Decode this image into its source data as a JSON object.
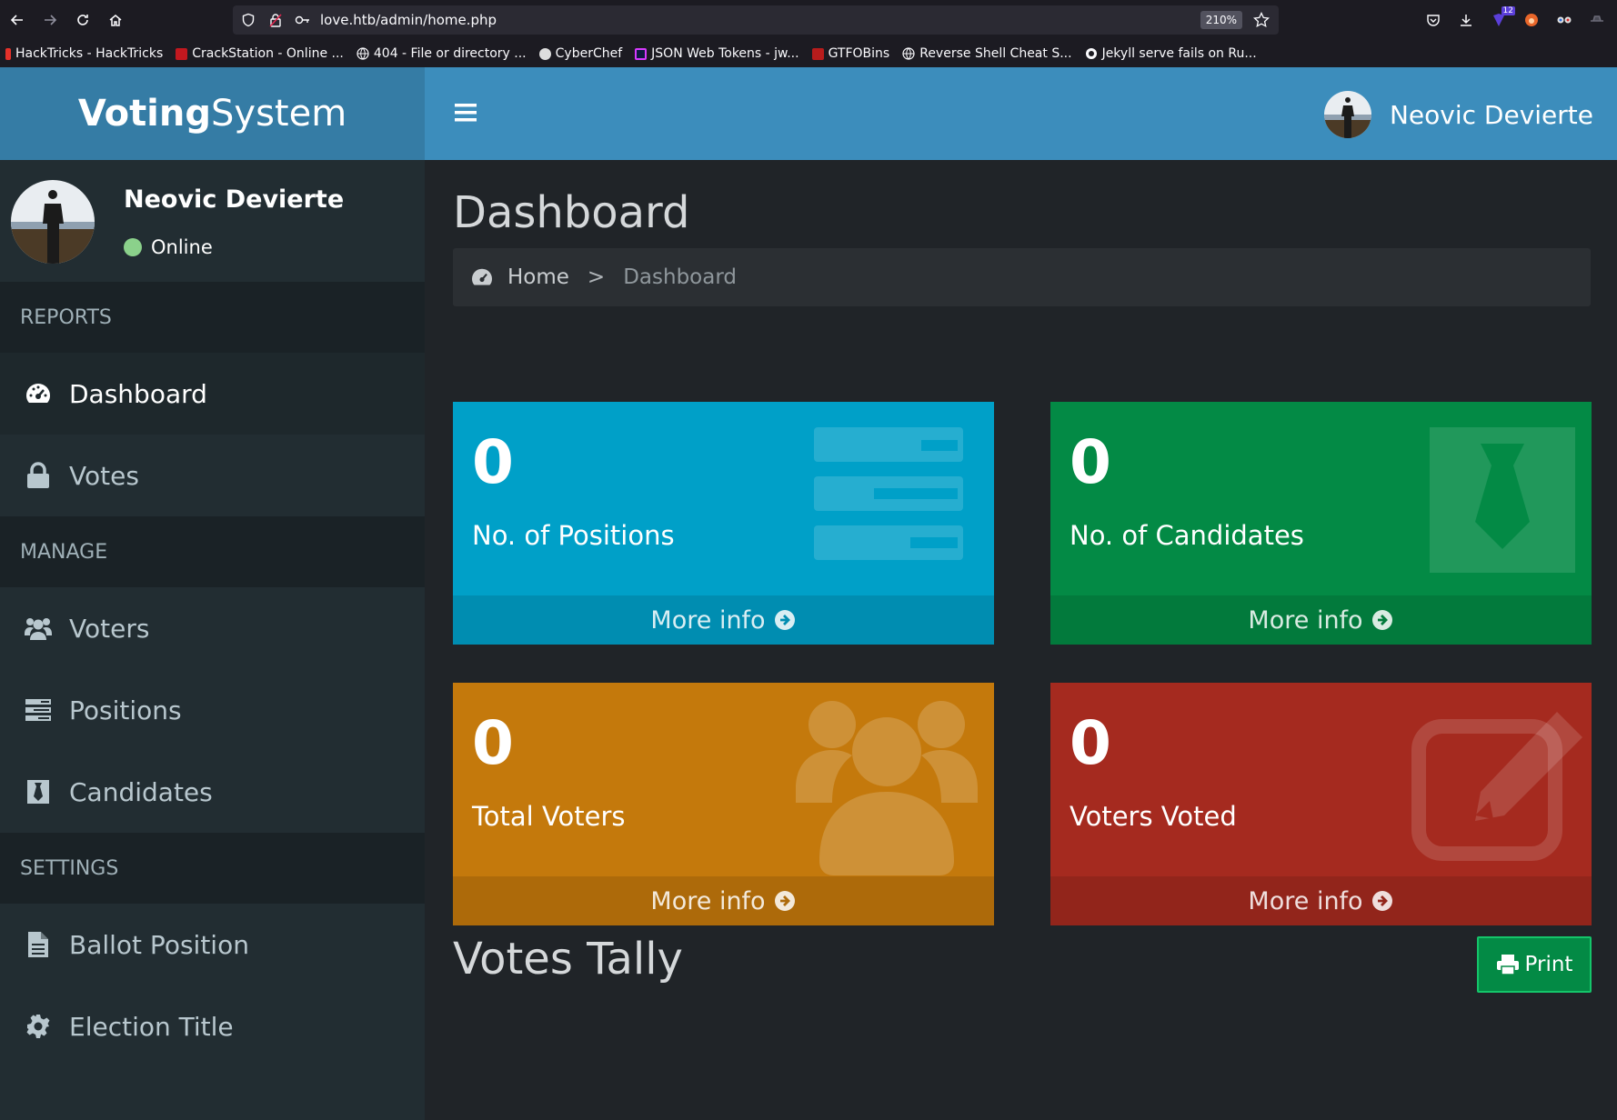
{
  "browser": {
    "url": "love.htb/admin/home.php",
    "zoom": "210%",
    "notification_count": "12",
    "bookmarks": [
      {
        "label": "HackTricks - HackTricks",
        "color": "#e5312a"
      },
      {
        "label": "CrackStation - Online ...",
        "color": "#c2181f"
      },
      {
        "label": "404 - File or directory ...",
        "color": "globe"
      },
      {
        "label": "CyberChef",
        "color": "#dddddd"
      },
      {
        "label": "JSON Web Tokens - jw...",
        "color": "#d63aff"
      },
      {
        "label": "GTFOBins",
        "color": "#b71c1c"
      },
      {
        "label": "Reverse Shell Cheat S...",
        "color": "globe"
      },
      {
        "label": "Jekyll serve fails on Ru...",
        "color": "github"
      }
    ]
  },
  "app": {
    "brand_bold": "Voting",
    "brand_light": "System",
    "user_name": "Neovic Devierte",
    "user_status": "Online"
  },
  "sidebar": {
    "headers": {
      "reports": "REPORTS",
      "manage": "MANAGE",
      "settings": "SETTINGS"
    },
    "items": [
      {
        "label": "Dashboard",
        "icon": "dashboard-icon"
      },
      {
        "label": "Votes",
        "icon": "lock-icon"
      },
      {
        "label": "Voters",
        "icon": "users-icon"
      },
      {
        "label": "Positions",
        "icon": "tasks-icon"
      },
      {
        "label": "Candidates",
        "icon": "tie-icon"
      },
      {
        "label": "Ballot Position",
        "icon": "file-icon"
      },
      {
        "label": "Election Title",
        "icon": "gear-icon"
      }
    ]
  },
  "content": {
    "title": "Dashboard",
    "breadcrumb": {
      "home": "Home",
      "separator": ">",
      "current": "Dashboard"
    },
    "boxes": [
      {
        "value": "0",
        "label": "No. of Positions",
        "footer": "More info",
        "color": "#00a0c8"
      },
      {
        "value": "0",
        "label": "No. of Candidates",
        "footer": "More info",
        "color": "#038a45"
      },
      {
        "value": "0",
        "label": "Total Voters",
        "footer": "More info",
        "color": "#c4790c"
      },
      {
        "value": "0",
        "label": "Voters Voted",
        "footer": "More info",
        "color": "#a52a1f"
      }
    ],
    "tally_title": "Votes Tally",
    "print_label": "Print"
  }
}
